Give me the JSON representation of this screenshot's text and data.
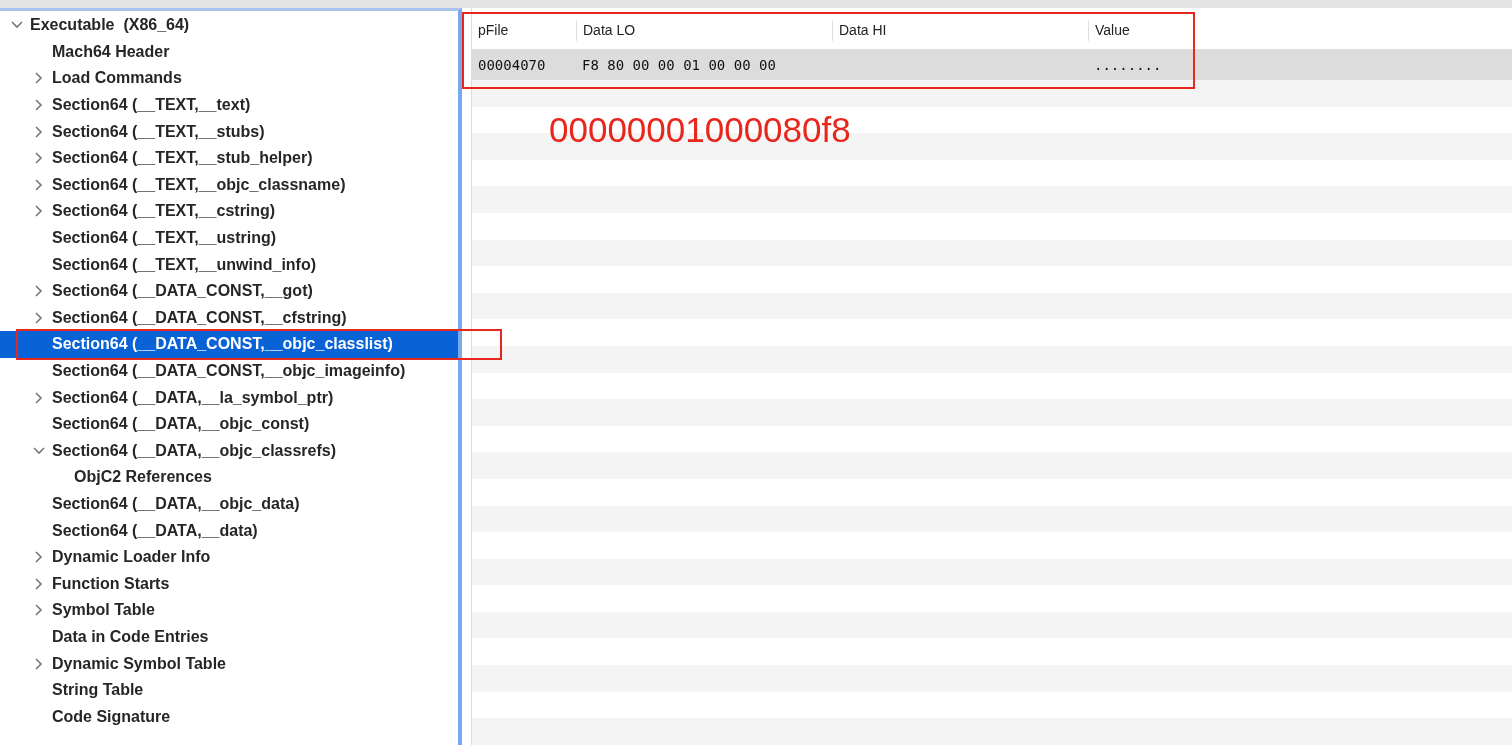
{
  "tree": [
    {
      "label": "Executable  (X86_64)",
      "expandable": true,
      "expanded": true,
      "selected": false,
      "children": [
        {
          "label": "Mach64 Header",
          "expandable": false,
          "selected": false
        },
        {
          "label": "Load Commands",
          "expandable": true,
          "expanded": false,
          "selected": false
        },
        {
          "label": "Section64 (__TEXT,__text)",
          "expandable": true,
          "expanded": false,
          "selected": false
        },
        {
          "label": "Section64 (__TEXT,__stubs)",
          "expandable": true,
          "expanded": false,
          "selected": false
        },
        {
          "label": "Section64 (__TEXT,__stub_helper)",
          "expandable": true,
          "expanded": false,
          "selected": false
        },
        {
          "label": "Section64 (__TEXT,__objc_classname)",
          "expandable": true,
          "expanded": false,
          "selected": false
        },
        {
          "label": "Section64 (__TEXT,__cstring)",
          "expandable": true,
          "expanded": false,
          "selected": false
        },
        {
          "label": "Section64 (__TEXT,__ustring)",
          "expandable": false,
          "selected": false
        },
        {
          "label": "Section64 (__TEXT,__unwind_info)",
          "expandable": false,
          "selected": false
        },
        {
          "label": "Section64 (__DATA_CONST,__got)",
          "expandable": true,
          "expanded": false,
          "selected": false
        },
        {
          "label": "Section64 (__DATA_CONST,__cfstring)",
          "expandable": true,
          "expanded": false,
          "selected": false
        },
        {
          "label": "Section64 (__DATA_CONST,__objc_classlist)",
          "expandable": false,
          "selected": true
        },
        {
          "label": "Section64 (__DATA_CONST,__objc_imageinfo)",
          "expandable": false,
          "selected": false
        },
        {
          "label": "Section64 (__DATA,__la_symbol_ptr)",
          "expandable": true,
          "expanded": false,
          "selected": false
        },
        {
          "label": "Section64 (__DATA,__objc_const)",
          "expandable": false,
          "selected": false
        },
        {
          "label": "Section64 (__DATA,__objc_classrefs)",
          "expandable": true,
          "expanded": true,
          "selected": false,
          "children": [
            {
              "label": "ObjC2 References",
              "expandable": false,
              "selected": false
            }
          ]
        },
        {
          "label": "Section64 (__DATA,__objc_data)",
          "expandable": false,
          "selected": false
        },
        {
          "label": "Section64 (__DATA,__data)",
          "expandable": false,
          "selected": false
        },
        {
          "label": "Dynamic Loader Info",
          "expandable": true,
          "expanded": false,
          "selected": false
        },
        {
          "label": "Function Starts",
          "expandable": true,
          "expanded": false,
          "selected": false
        },
        {
          "label": "Symbol Table",
          "expandable": true,
          "expanded": false,
          "selected": false
        },
        {
          "label": "Data in Code Entries",
          "expandable": false,
          "selected": false
        },
        {
          "label": "Dynamic Symbol Table",
          "expandable": true,
          "expanded": false,
          "selected": false
        },
        {
          "label": "String Table",
          "expandable": false,
          "selected": false
        },
        {
          "label": "Code Signature",
          "expandable": false,
          "selected": false
        }
      ]
    }
  ],
  "table": {
    "columns": [
      "pFile",
      "Data LO",
      "Data HI",
      "Value"
    ],
    "rows": [
      {
        "cells": [
          "00004070",
          "F8 80 00 00 01 00 00 00",
          "",
          "........"
        ],
        "selected": true
      }
    ]
  },
  "annotation": "00000001000080f8"
}
